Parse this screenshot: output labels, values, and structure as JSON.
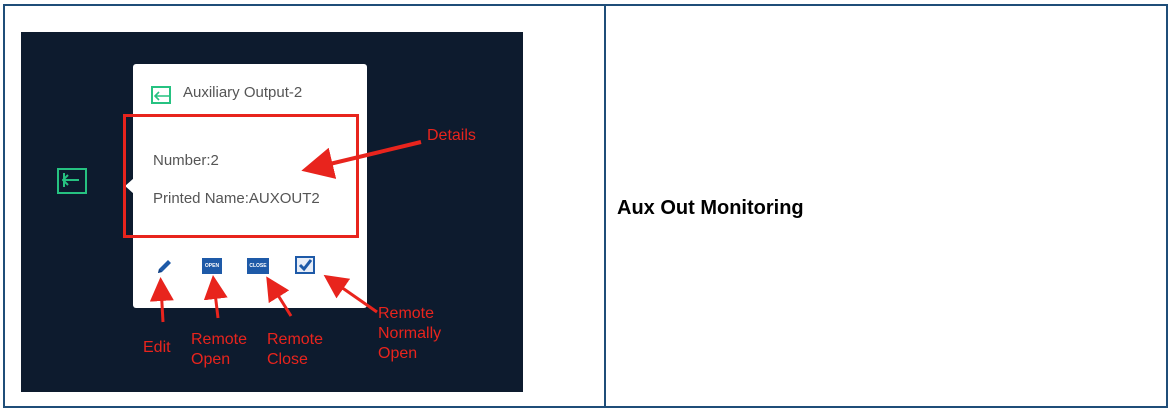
{
  "popover": {
    "title": "Auxiliary Output-2",
    "number_line": "Number:2",
    "printed_name_line": "Printed Name:AUXOUT2",
    "buttons": {
      "open_label": "OPEN",
      "close_label": "CLOSE"
    }
  },
  "annotations": {
    "details": "Details",
    "edit": "Edit",
    "remote_open": [
      "Remote",
      "Open"
    ],
    "remote_close": [
      "Remote",
      "Close"
    ],
    "remote_normally_open": [
      "Remote",
      "Normally",
      "Open"
    ]
  },
  "caption": "Aux Out Monitoring",
  "icons": {
    "aux_output": "aux-output-icon",
    "edit": "pencil-icon",
    "normally_open": "checkbox-check-icon"
  },
  "colors": {
    "table_border": "#1f4e79",
    "screenshot_bg": "#0d1b2e",
    "accent_green": "#26c281",
    "annotation_red": "#e8241d",
    "button_blue": "#1e5aa8"
  }
}
